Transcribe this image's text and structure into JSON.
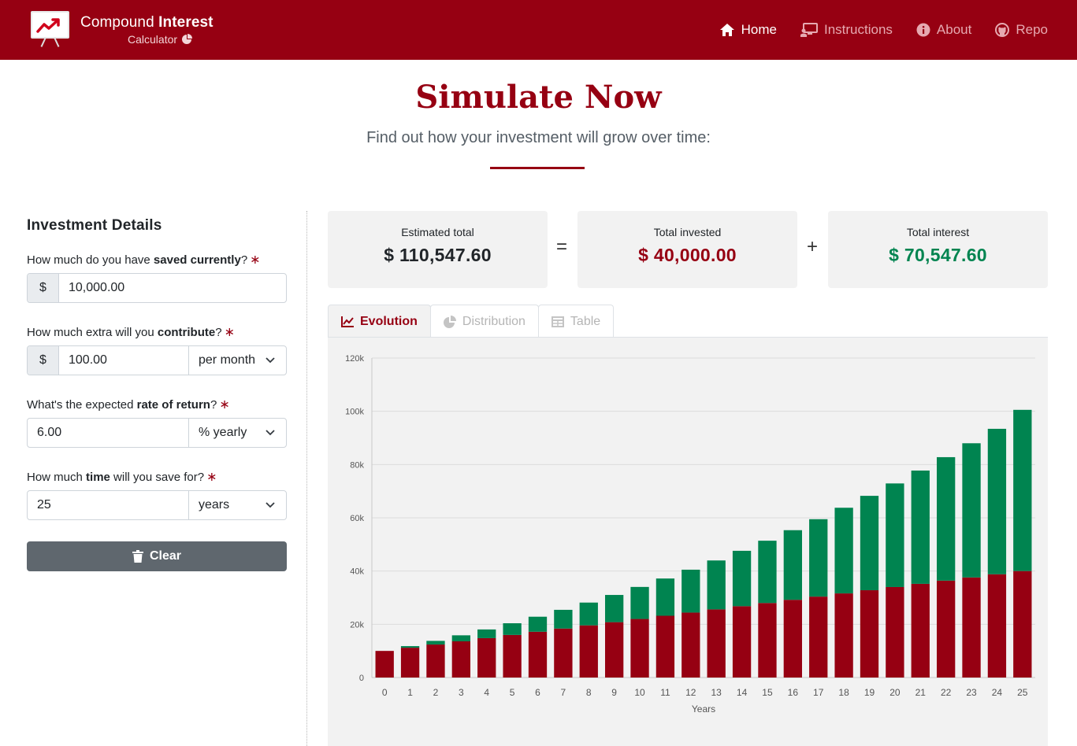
{
  "brand": {
    "title_light": "Compound ",
    "title_bold": "Interest",
    "subtitle": "Calculator"
  },
  "nav": [
    {
      "label": "Home",
      "icon": "home-icon",
      "active": true
    },
    {
      "label": "Instructions",
      "icon": "presentation-icon",
      "active": false
    },
    {
      "label": "About",
      "icon": "info-icon",
      "active": false
    },
    {
      "label": "Repo",
      "icon": "github-icon",
      "active": false
    }
  ],
  "hero": {
    "title": "Simulate Now",
    "subtitle": "Find out how your investment will grow over time:"
  },
  "form": {
    "heading": "Investment Details",
    "saved": {
      "pre": "How much do you have ",
      "bold": "saved currently",
      "post": "?",
      "prefix": "$",
      "value": "10,000.00"
    },
    "contribute": {
      "pre": "How much extra will you ",
      "bold": "contribute",
      "post": "?",
      "prefix": "$",
      "value": "100.00",
      "select": "per month"
    },
    "rate": {
      "pre": "What's the expected ",
      "bold": "rate of return",
      "post": "?",
      "value": "6.00",
      "select": "% yearly"
    },
    "time": {
      "pre": "How much ",
      "bold": "time",
      "post": " will you save for?",
      "value": "25",
      "select": "years"
    },
    "required_mark": "∗",
    "clear_label": "Clear"
  },
  "summary": {
    "total": {
      "label": "Estimated total",
      "value": "$ 110,547.60"
    },
    "invested": {
      "label": "Total invested",
      "value": "$ 40,000.00"
    },
    "interest": {
      "label": "Total interest",
      "value": "$ 70,547.60"
    },
    "op_equals": "=",
    "op_plus": "+"
  },
  "tabs": [
    {
      "label": "Evolution",
      "icon": "line-chart-icon",
      "active": true
    },
    {
      "label": "Distribution",
      "icon": "pie-chart-icon",
      "active": false
    },
    {
      "label": "Table",
      "icon": "table-icon",
      "active": false
    }
  ],
  "colors": {
    "brand": "#960012",
    "invested": "#960012",
    "interest": "#008450",
    "clear_button": "#5f676e"
  },
  "chart_data": {
    "type": "bar",
    "stacked": true,
    "xlabel": "Years",
    "ylabel": "",
    "ylim": [
      0,
      120000
    ],
    "yticks": [
      0,
      20000,
      40000,
      60000,
      80000,
      100000,
      120000
    ],
    "ytick_labels": [
      "0",
      "20k",
      "40k",
      "60k",
      "80k",
      "100k",
      "120k"
    ],
    "grid": true,
    "categories": [
      "0",
      "1",
      "2",
      "3",
      "4",
      "5",
      "6",
      "7",
      "8",
      "9",
      "10",
      "11",
      "12",
      "13",
      "14",
      "15",
      "16",
      "17",
      "18",
      "19",
      "20",
      "21",
      "22",
      "23",
      "24",
      "25"
    ],
    "series": [
      {
        "color": "#960012",
        "values": [
          10000,
          11200,
          12400,
          13600,
          14800,
          16000,
          17200,
          18400,
          19600,
          20800,
          22000,
          23200,
          24400,
          25600,
          26800,
          28000,
          29200,
          30400,
          31600,
          32800,
          34000,
          35200,
          36400,
          37600,
          38800,
          40000
        ]
      },
      {
        "color": "#008450",
        "values": [
          0,
          600,
          1372,
          2258,
          3262,
          4390,
          5645,
          7033,
          8557,
          10221,
          12034,
          13995,
          16108,
          18375,
          20803,
          23392,
          26149,
          29074,
          32173,
          35448,
          38905,
          42546,
          46375,
          50398,
          54620,
          60548
        ]
      }
    ]
  }
}
